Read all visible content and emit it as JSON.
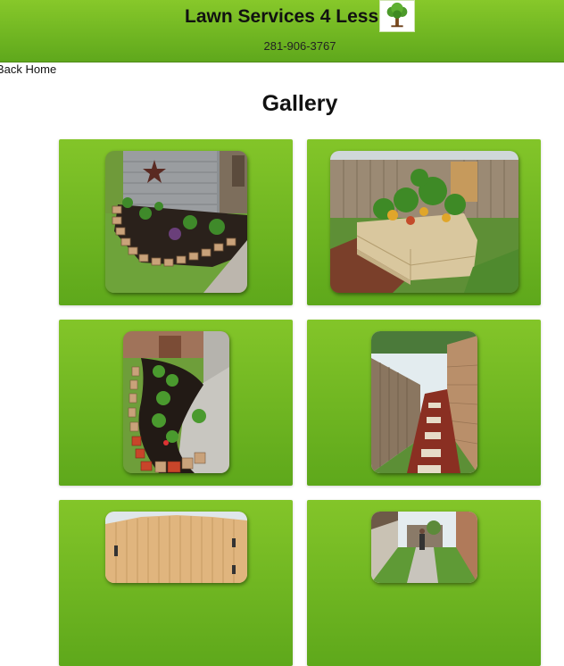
{
  "header": {
    "title": "Lawn Services 4 Less",
    "phone": "281-906-3767",
    "logo_icon": "tree-icon"
  },
  "nav": {
    "back_label": "Back Home"
  },
  "gallery": {
    "title": "Gallery",
    "photos": [
      {
        "subject": "mulch flower bed with stone border beside brick house"
      },
      {
        "subject": "raised wooden garden bed with tropical plants"
      },
      {
        "subject": "curved mulch bed with red and tan edging stones"
      },
      {
        "subject": "side yard paver walkway along wooden fence"
      },
      {
        "subject": "new wooden privacy fence gate"
      },
      {
        "subject": "narrow side yard drainage path between houses"
      }
    ]
  },
  "colors": {
    "header_green": "#6cb522",
    "card_green": "#72b823"
  }
}
